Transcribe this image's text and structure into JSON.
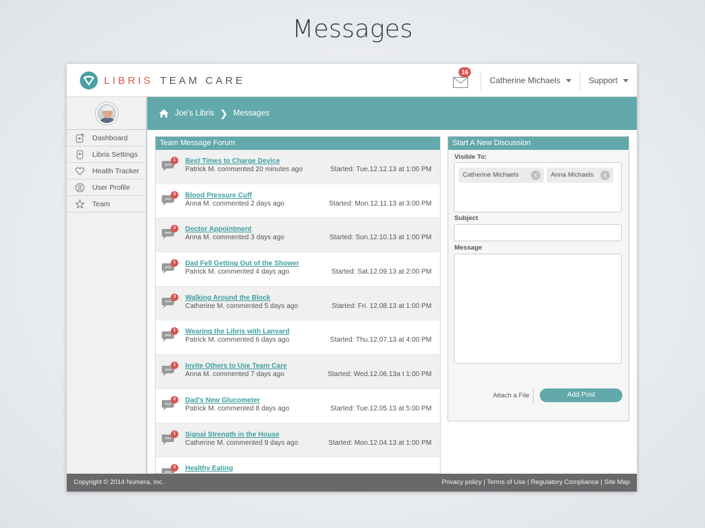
{
  "slide_title": "Messages",
  "brand": {
    "name1": "LIBRIS",
    "name2": "TEAM CARE",
    "accent": "#63a9ab",
    "logo_red": "#d9534f"
  },
  "header": {
    "mail_count": "16",
    "user_name": "Catherine Michaels",
    "support_label": "Support"
  },
  "sidebar": {
    "items": [
      {
        "label": "Dashboard",
        "icon": "dashboard-icon"
      },
      {
        "label": "Libris Settings",
        "icon": "settings-icon"
      },
      {
        "label": "Health Tracker",
        "icon": "heart-icon"
      },
      {
        "label": "User Profile",
        "icon": "user-profile-icon"
      },
      {
        "label": "Team",
        "icon": "star-icon"
      }
    ]
  },
  "breadcrumb": {
    "home": "Joe's Libris",
    "current": "Messages"
  },
  "forum": {
    "title": "Team Message Forum",
    "messages": [
      {
        "badge": "1",
        "title": "Best Times to Charge Device",
        "sub": "Patrick M. commented 20 minutes ago",
        "started": "Started: Tue.12.12.13 at 1:00 PM"
      },
      {
        "badge": "3",
        "title": "Blood Pressure Cuff",
        "sub": "Anna M. commented 2 days ago",
        "started": "Started: Mon.12.11.13 at 3:00 PM"
      },
      {
        "badge": "2",
        "title": "Doctor Appointment",
        "sub": "Anna M. commented 3 days ago",
        "started": "Started: Sun.12.10.13 at 1:00 PM"
      },
      {
        "badge": "1",
        "title": "Dad Fell Getting Out of the Shower",
        "sub": "Patrick M. commented 4 days ago",
        "started": "Started: Sat.12.09.13 at 2:00 PM"
      },
      {
        "badge": "3",
        "title": "Walking Around the Block",
        "sub": "Catherine M. commented 5 days ago",
        "started": "Started: Fri. 12.08.13 at 1:00 PM"
      },
      {
        "badge": "1",
        "title": "Wearing the Libris with Lanyard",
        "sub": "Patrick M. commented 6 days ago",
        "started": "Started: Thu.12.07.13 at 4:00 PM"
      },
      {
        "badge": "1",
        "title": "Invite Others to Use Team Care",
        "sub": "Anna M. commented 7 days ago",
        "started": "Started: Wed.12.06.13a t 1:00 PM"
      },
      {
        "badge": "2",
        "title": "Dad's New Glucometer",
        "sub": "Patrick M. commented 8 days ago",
        "started": "Started: Tue.12.05.13 at 5:00 PM"
      },
      {
        "badge": "1",
        "title": "Signal Strength in the House",
        "sub": "Catherine M. commented 9 days ago",
        "started": "Started: Mon.12.04.13 at 1:00 PM"
      },
      {
        "badge": "2",
        "title": "Healthy Eating",
        "sub": "",
        "started": ""
      }
    ]
  },
  "new_discussion": {
    "title": "Start A New Discussion",
    "visible_to_label": "Visible To:",
    "recipients": [
      "Catherine Michaels",
      "Anna Michaels"
    ],
    "chip_remove": "x",
    "subject_label": "Subject",
    "subject_value": "",
    "message_label": "Message",
    "message_value": "",
    "attach_label": "Attach a File",
    "add_post_label": "Add Post"
  },
  "footer": {
    "copyright": "Copyright © 2014 Numera, Inc.",
    "links": [
      "Privacy policy",
      "Terms of Use",
      "Regulatory Compliance",
      "Site Map"
    ],
    "separator": " | "
  }
}
